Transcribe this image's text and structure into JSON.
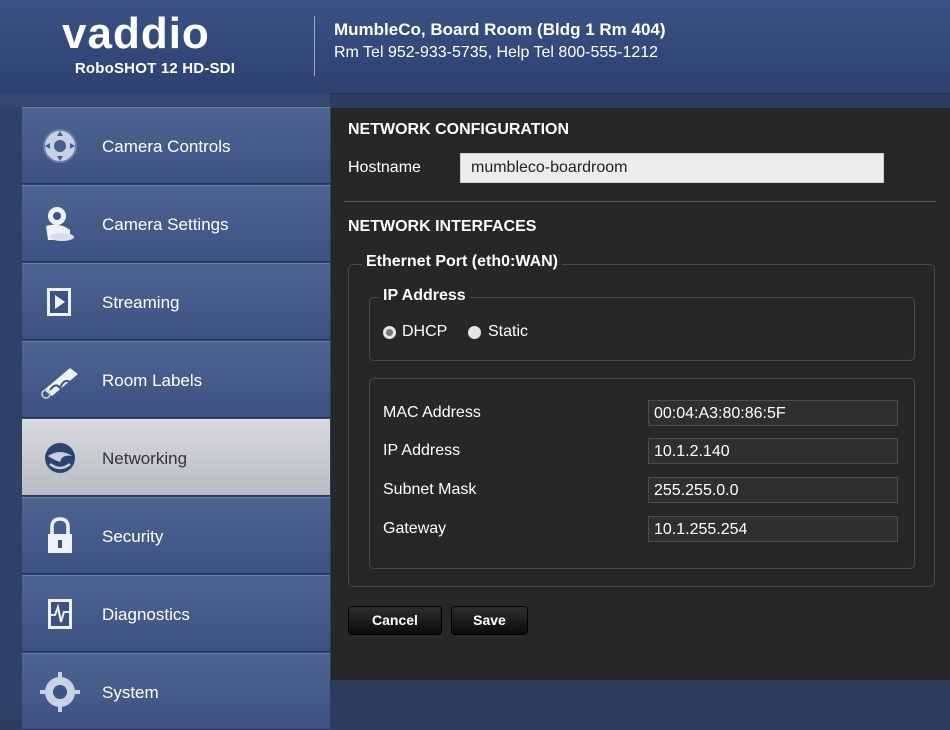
{
  "header": {
    "logo_text": "vaddio",
    "product_name": "RoboSHOT 12 HD-SDI",
    "room_title": "MumbleCo, Board Room (Bldg 1 Rm 404)",
    "room_tel": "Rm Tel 952-933-5735, Help Tel 800-555-1212"
  },
  "sidebar": {
    "items": [
      {
        "label": "Camera Controls",
        "icon": "joystick-icon",
        "active": false
      },
      {
        "label": "Camera Settings",
        "icon": "camera-settings-icon",
        "active": false
      },
      {
        "label": "Streaming",
        "icon": "streaming-icon",
        "active": false
      },
      {
        "label": "Room Labels",
        "icon": "room-labels-icon",
        "active": false
      },
      {
        "label": "Networking",
        "icon": "networking-icon",
        "active": true
      },
      {
        "label": "Security",
        "icon": "lock-icon",
        "active": false
      },
      {
        "label": "Diagnostics",
        "icon": "diagnostics-icon",
        "active": false
      },
      {
        "label": "System",
        "icon": "system-icon",
        "active": false
      }
    ]
  },
  "network_config": {
    "heading": "NETWORK CONFIGURATION",
    "hostname_label": "Hostname",
    "hostname_value": "mumbleco-boardroom"
  },
  "network_interfaces": {
    "heading": "NETWORK INTERFACES",
    "ethernet_legend": "Ethernet Port (eth0:WAN)",
    "ip_legend": "IP Address",
    "dhcp_label": "DHCP",
    "static_label": "Static",
    "selected_mode": "DHCP",
    "fields": {
      "mac": {
        "label": "MAC Address",
        "value": "00:04:A3:80:86:5F"
      },
      "ip": {
        "label": "IP Address",
        "value": "10.1.2.140"
      },
      "subnet": {
        "label": "Subnet Mask",
        "value": "255.255.0.0"
      },
      "gateway": {
        "label": "Gateway",
        "value": "10.1.255.254"
      }
    }
  },
  "buttons": {
    "cancel_label": "Cancel",
    "save_label": "Save"
  },
  "colors": {
    "header_bg": "#34497a",
    "sidebar_bg": "#3d5282",
    "active_nav_bg": "#c4c6cb",
    "panel_bg": "#272727"
  }
}
